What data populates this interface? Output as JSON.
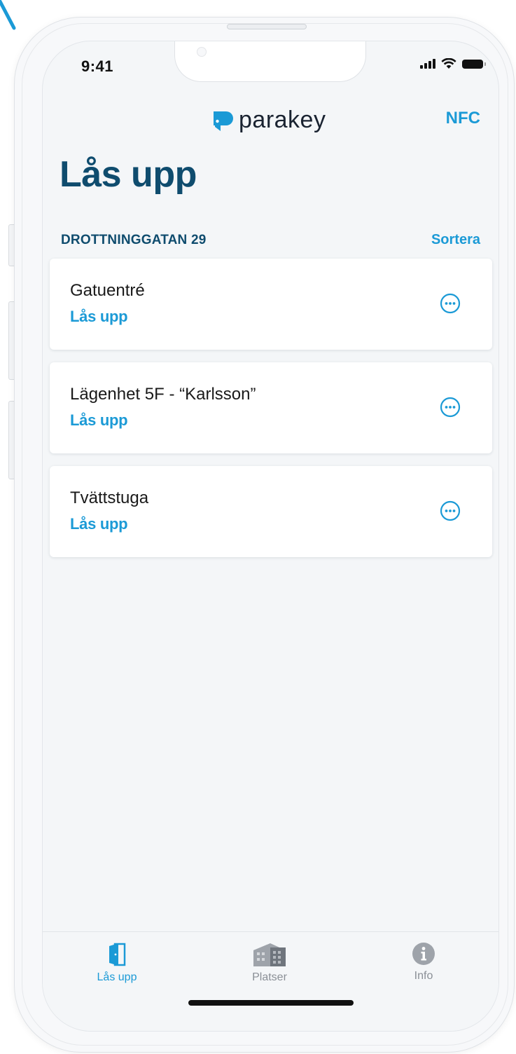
{
  "status_bar": {
    "time": "9:41"
  },
  "header": {
    "brand": "parakey",
    "nfc_label": "NFC"
  },
  "page": {
    "title": "Lås upp"
  },
  "section": {
    "title": "DROTTNINGGATAN 29",
    "sort_label": "Sortera"
  },
  "doors": [
    {
      "name": "Gatuentré",
      "action": "Lås upp"
    },
    {
      "name": "Lägenhet 5F - “Karlsson”",
      "action": "Lås upp"
    },
    {
      "name": "Tvättstuga",
      "action": "Lås upp"
    }
  ],
  "tabs": [
    {
      "label": "Lås upp",
      "icon": "door-icon",
      "active": true
    },
    {
      "label": "Platser",
      "icon": "building-icon",
      "active": false
    },
    {
      "label": "Info",
      "icon": "info-icon",
      "active": false
    }
  ],
  "colors": {
    "accent": "#1b9ad6",
    "title": "#0f4c6e",
    "inactive_tab": "#8a8f96"
  }
}
